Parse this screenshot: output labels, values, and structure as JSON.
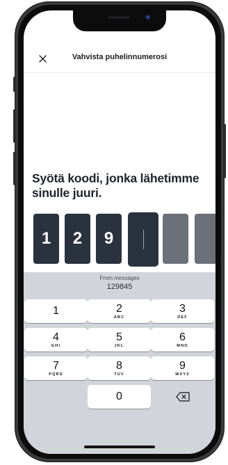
{
  "header": {
    "title": "Vahvista puhelinnumerosi"
  },
  "heading": "Syötä koodi, jonka lähetimme sinulle juuri.",
  "code": {
    "digits": [
      "1",
      "2",
      "9",
      "",
      "",
      ""
    ],
    "active_index": 3
  },
  "keyboard": {
    "suggestion_label": "From messages",
    "suggestion_code": "129845",
    "keys": [
      {
        "num": "1",
        "letters": ""
      },
      {
        "num": "2",
        "letters": "ABC"
      },
      {
        "num": "3",
        "letters": "DEF"
      },
      {
        "num": "4",
        "letters": "GHI"
      },
      {
        "num": "5",
        "letters": "JKL"
      },
      {
        "num": "6",
        "letters": "MNO"
      },
      {
        "num": "7",
        "letters": "PQRS"
      },
      {
        "num": "8",
        "letters": "TUV"
      },
      {
        "num": "9",
        "letters": "WXYZ"
      },
      {
        "num": "0",
        "letters": ""
      }
    ]
  },
  "icons": {
    "close": "close-icon",
    "delete": "backspace-icon"
  },
  "colors": {
    "code_box_filled": "#2a323d",
    "code_box_empty": "#6b7079",
    "keyboard_bg": "#d1d4db"
  }
}
